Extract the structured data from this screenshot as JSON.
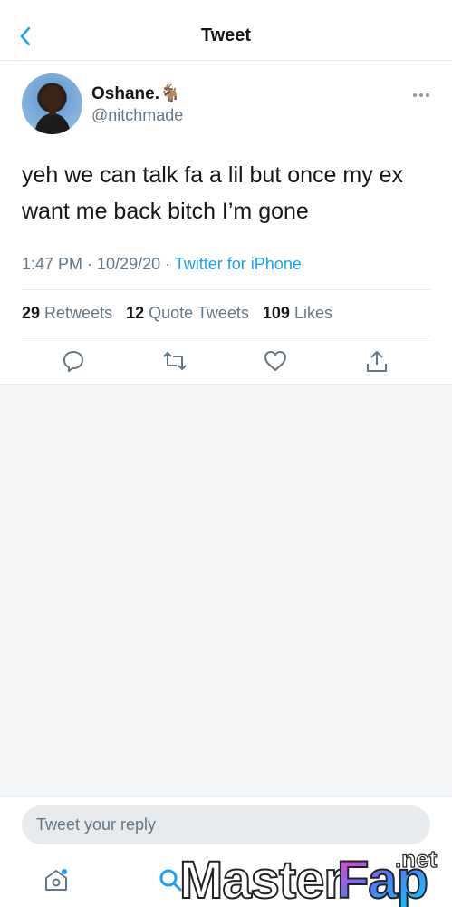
{
  "header": {
    "title": "Tweet"
  },
  "tweet": {
    "author_name": "Oshane.🐐",
    "author_handle": "@nitchmade",
    "text": "yeh we can talk fa a lil but once my ex want me back bitch I’m gone",
    "time": "1:47 PM · 10/29/20 · ",
    "source": "Twitter for iPhone"
  },
  "stats": {
    "retweets_count": "29",
    "retweets_label": "Retweets",
    "quotes_count": "12",
    "quotes_label": "Quote Tweets",
    "likes_count": "109",
    "likes_label": "Likes"
  },
  "actions": [
    "reply-icon",
    "retweet-icon",
    "like-icon",
    "share-icon"
  ],
  "reply": {
    "placeholder": "Tweet your reply"
  },
  "tabs": [
    "home-icon",
    "search-icon"
  ],
  "watermark": {
    "text_main": "MasterFap",
    "text_suffix": ".net"
  },
  "colors": {
    "accent": "#1da1f2",
    "secondary_text": "#657786",
    "divider": "#e6ecf0"
  }
}
